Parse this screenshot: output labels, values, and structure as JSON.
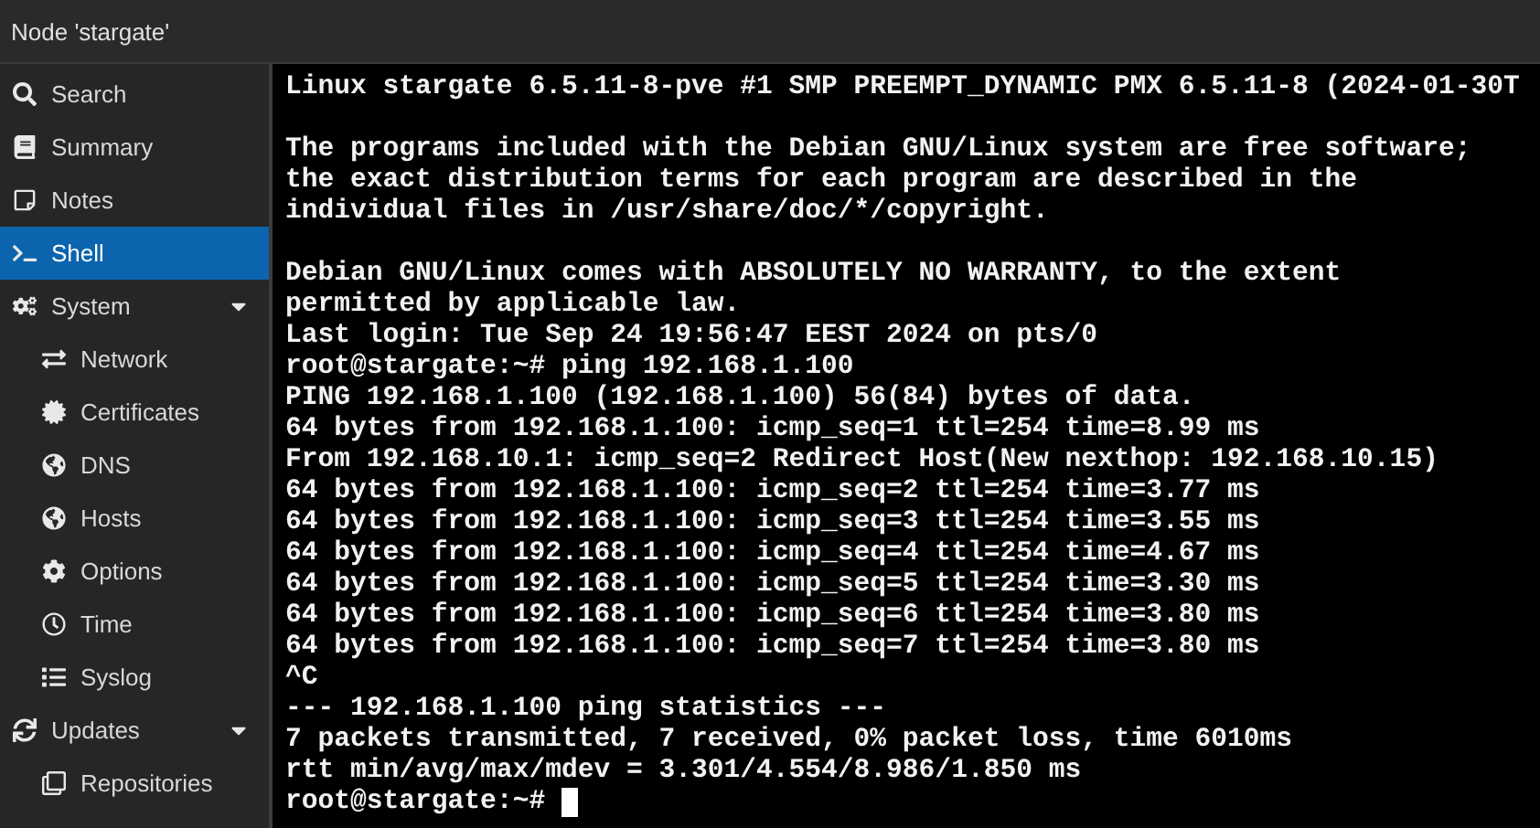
{
  "window": {
    "title": "Node 'stargate'"
  },
  "sidebar": {
    "items": [
      {
        "label": "Search",
        "selected": false
      },
      {
        "label": "Summary",
        "selected": false
      },
      {
        "label": "Notes",
        "selected": false
      },
      {
        "label": "Shell",
        "selected": true
      },
      {
        "label": "System",
        "selected": false,
        "expanded": true,
        "children": [
          {
            "label": "Network",
            "selected": false
          },
          {
            "label": "Certificates",
            "selected": false
          },
          {
            "label": "DNS",
            "selected": false
          },
          {
            "label": "Hosts",
            "selected": false
          },
          {
            "label": "Options",
            "selected": false
          },
          {
            "label": "Time",
            "selected": false
          },
          {
            "label": "Syslog",
            "selected": false
          }
        ]
      },
      {
        "label": "Updates",
        "selected": false,
        "expanded": true,
        "children": [
          {
            "label": "Repositories",
            "selected": false
          }
        ]
      }
    ]
  },
  "terminal": {
    "blocks": [
      [
        "Linux stargate 6.5.11-8-pve #1 SMP PREEMPT_DYNAMIC PMX 6.5.11-8 (2024-01-30T"
      ],
      [
        "The programs included with the Debian GNU/Linux system are free software;",
        "the exact distribution terms for each program are described in the",
        "individual files in /usr/share/doc/*/copyright."
      ],
      [
        "Debian GNU/Linux comes with ABSOLUTELY NO WARRANTY, to the extent",
        "permitted by applicable law.",
        "Last login: Tue Sep 24 19:56:47 EEST 2024 on pts/0",
        "root@stargate:~# ping 192.168.1.100",
        "PING 192.168.1.100 (192.168.1.100) 56(84) bytes of data.",
        "64 bytes from 192.168.1.100: icmp_seq=1 ttl=254 time=8.99 ms",
        "From 192.168.10.1: icmp_seq=2 Redirect Host(New nexthop: 192.168.10.15)",
        "64 bytes from 192.168.1.100: icmp_seq=2 ttl=254 time=3.77 ms",
        "64 bytes from 192.168.1.100: icmp_seq=3 ttl=254 time=3.55 ms",
        "64 bytes from 192.168.1.100: icmp_seq=4 ttl=254 time=4.67 ms",
        "64 bytes from 192.168.1.100: icmp_seq=5 ttl=254 time=3.30 ms",
        "64 bytes from 192.168.1.100: icmp_seq=6 ttl=254 time=3.80 ms",
        "64 bytes from 192.168.1.100: icmp_seq=7 ttl=254 time=3.80 ms",
        "^C",
        "--- 192.168.1.100 ping statistics ---",
        "7 packets transmitted, 7 received, 0% packet loss, time 6010ms",
        "rtt min/avg/max/mdev = 3.301/4.554/8.986/1.850 ms"
      ]
    ],
    "prompt": "root@stargate:~#"
  }
}
